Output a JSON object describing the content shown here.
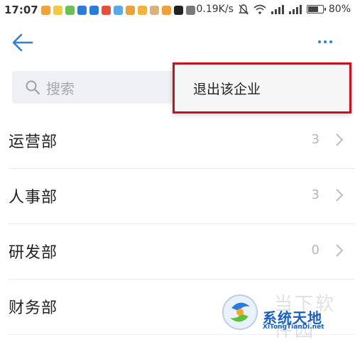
{
  "status_bar": {
    "time": "17:07",
    "network_speed": "0.19K/s",
    "battery_percent": "80%",
    "battery_level": 0.8,
    "notification_icon_colors": [
      "#f2a23b",
      "#f5c842",
      "#6bbf59",
      "#2b7bd8",
      "#2b7bd8",
      "#e84e3c",
      "#5aa9e6",
      "#e8a23b",
      "#f0b43c",
      "#d8b47a",
      "#f0a03b",
      "#222222",
      "#7a7a7a"
    ]
  },
  "header": {
    "back_icon": "arrow-left-icon",
    "more_icon": "more-dots-icon",
    "accent_color": "#2f80d6"
  },
  "search": {
    "placeholder": "搜索",
    "icon": "search-icon"
  },
  "menu": {
    "items": [
      {
        "label": "退出该企业"
      }
    ],
    "highlight_color": "#c8101e"
  },
  "departments": [
    {
      "name": "运营部",
      "count": "3"
    },
    {
      "name": "人事部",
      "count": "3"
    },
    {
      "name": "研发部",
      "count": "0"
    },
    {
      "name": "财务部",
      "count": ""
    }
  ],
  "watermark": {
    "faint_text": "当下软件园",
    "title": "系统天地",
    "url": "XiTongTianDi.net"
  }
}
